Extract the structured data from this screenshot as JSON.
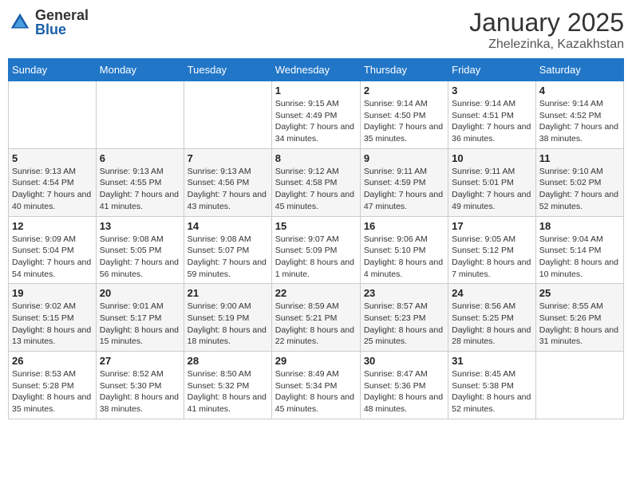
{
  "header": {
    "logo_general": "General",
    "logo_blue": "Blue",
    "month_year": "January 2025",
    "location": "Zhelezinka, Kazakhstan"
  },
  "weekdays": [
    "Sunday",
    "Monday",
    "Tuesday",
    "Wednesday",
    "Thursday",
    "Friday",
    "Saturday"
  ],
  "weeks": [
    [
      {
        "day": "",
        "sunrise": "",
        "sunset": "",
        "daylight": ""
      },
      {
        "day": "",
        "sunrise": "",
        "sunset": "",
        "daylight": ""
      },
      {
        "day": "",
        "sunrise": "",
        "sunset": "",
        "daylight": ""
      },
      {
        "day": "1",
        "sunrise": "Sunrise: 9:15 AM",
        "sunset": "Sunset: 4:49 PM",
        "daylight": "Daylight: 7 hours and 34 minutes."
      },
      {
        "day": "2",
        "sunrise": "Sunrise: 9:14 AM",
        "sunset": "Sunset: 4:50 PM",
        "daylight": "Daylight: 7 hours and 35 minutes."
      },
      {
        "day": "3",
        "sunrise": "Sunrise: 9:14 AM",
        "sunset": "Sunset: 4:51 PM",
        "daylight": "Daylight: 7 hours and 36 minutes."
      },
      {
        "day": "4",
        "sunrise": "Sunrise: 9:14 AM",
        "sunset": "Sunset: 4:52 PM",
        "daylight": "Daylight: 7 hours and 38 minutes."
      }
    ],
    [
      {
        "day": "5",
        "sunrise": "Sunrise: 9:13 AM",
        "sunset": "Sunset: 4:54 PM",
        "daylight": "Daylight: 7 hours and 40 minutes."
      },
      {
        "day": "6",
        "sunrise": "Sunrise: 9:13 AM",
        "sunset": "Sunset: 4:55 PM",
        "daylight": "Daylight: 7 hours and 41 minutes."
      },
      {
        "day": "7",
        "sunrise": "Sunrise: 9:13 AM",
        "sunset": "Sunset: 4:56 PM",
        "daylight": "Daylight: 7 hours and 43 minutes."
      },
      {
        "day": "8",
        "sunrise": "Sunrise: 9:12 AM",
        "sunset": "Sunset: 4:58 PM",
        "daylight": "Daylight: 7 hours and 45 minutes."
      },
      {
        "day": "9",
        "sunrise": "Sunrise: 9:11 AM",
        "sunset": "Sunset: 4:59 PM",
        "daylight": "Daylight: 7 hours and 47 minutes."
      },
      {
        "day": "10",
        "sunrise": "Sunrise: 9:11 AM",
        "sunset": "Sunset: 5:01 PM",
        "daylight": "Daylight: 7 hours and 49 minutes."
      },
      {
        "day": "11",
        "sunrise": "Sunrise: 9:10 AM",
        "sunset": "Sunset: 5:02 PM",
        "daylight": "Daylight: 7 hours and 52 minutes."
      }
    ],
    [
      {
        "day": "12",
        "sunrise": "Sunrise: 9:09 AM",
        "sunset": "Sunset: 5:04 PM",
        "daylight": "Daylight: 7 hours and 54 minutes."
      },
      {
        "day": "13",
        "sunrise": "Sunrise: 9:08 AM",
        "sunset": "Sunset: 5:05 PM",
        "daylight": "Daylight: 7 hours and 56 minutes."
      },
      {
        "day": "14",
        "sunrise": "Sunrise: 9:08 AM",
        "sunset": "Sunset: 5:07 PM",
        "daylight": "Daylight: 7 hours and 59 minutes."
      },
      {
        "day": "15",
        "sunrise": "Sunrise: 9:07 AM",
        "sunset": "Sunset: 5:09 PM",
        "daylight": "Daylight: 8 hours and 1 minute."
      },
      {
        "day": "16",
        "sunrise": "Sunrise: 9:06 AM",
        "sunset": "Sunset: 5:10 PM",
        "daylight": "Daylight: 8 hours and 4 minutes."
      },
      {
        "day": "17",
        "sunrise": "Sunrise: 9:05 AM",
        "sunset": "Sunset: 5:12 PM",
        "daylight": "Daylight: 8 hours and 7 minutes."
      },
      {
        "day": "18",
        "sunrise": "Sunrise: 9:04 AM",
        "sunset": "Sunset: 5:14 PM",
        "daylight": "Daylight: 8 hours and 10 minutes."
      }
    ],
    [
      {
        "day": "19",
        "sunrise": "Sunrise: 9:02 AM",
        "sunset": "Sunset: 5:15 PM",
        "daylight": "Daylight: 8 hours and 13 minutes."
      },
      {
        "day": "20",
        "sunrise": "Sunrise: 9:01 AM",
        "sunset": "Sunset: 5:17 PM",
        "daylight": "Daylight: 8 hours and 15 minutes."
      },
      {
        "day": "21",
        "sunrise": "Sunrise: 9:00 AM",
        "sunset": "Sunset: 5:19 PM",
        "daylight": "Daylight: 8 hours and 18 minutes."
      },
      {
        "day": "22",
        "sunrise": "Sunrise: 8:59 AM",
        "sunset": "Sunset: 5:21 PM",
        "daylight": "Daylight: 8 hours and 22 minutes."
      },
      {
        "day": "23",
        "sunrise": "Sunrise: 8:57 AM",
        "sunset": "Sunset: 5:23 PM",
        "daylight": "Daylight: 8 hours and 25 minutes."
      },
      {
        "day": "24",
        "sunrise": "Sunrise: 8:56 AM",
        "sunset": "Sunset: 5:25 PM",
        "daylight": "Daylight: 8 hours and 28 minutes."
      },
      {
        "day": "25",
        "sunrise": "Sunrise: 8:55 AM",
        "sunset": "Sunset: 5:26 PM",
        "daylight": "Daylight: 8 hours and 31 minutes."
      }
    ],
    [
      {
        "day": "26",
        "sunrise": "Sunrise: 8:53 AM",
        "sunset": "Sunset: 5:28 PM",
        "daylight": "Daylight: 8 hours and 35 minutes."
      },
      {
        "day": "27",
        "sunrise": "Sunrise: 8:52 AM",
        "sunset": "Sunset: 5:30 PM",
        "daylight": "Daylight: 8 hours and 38 minutes."
      },
      {
        "day": "28",
        "sunrise": "Sunrise: 8:50 AM",
        "sunset": "Sunset: 5:32 PM",
        "daylight": "Daylight: 8 hours and 41 minutes."
      },
      {
        "day": "29",
        "sunrise": "Sunrise: 8:49 AM",
        "sunset": "Sunset: 5:34 PM",
        "daylight": "Daylight: 8 hours and 45 minutes."
      },
      {
        "day": "30",
        "sunrise": "Sunrise: 8:47 AM",
        "sunset": "Sunset: 5:36 PM",
        "daylight": "Daylight: 8 hours and 48 minutes."
      },
      {
        "day": "31",
        "sunrise": "Sunrise: 8:45 AM",
        "sunset": "Sunset: 5:38 PM",
        "daylight": "Daylight: 8 hours and 52 minutes."
      },
      {
        "day": "",
        "sunrise": "",
        "sunset": "",
        "daylight": ""
      }
    ]
  ]
}
